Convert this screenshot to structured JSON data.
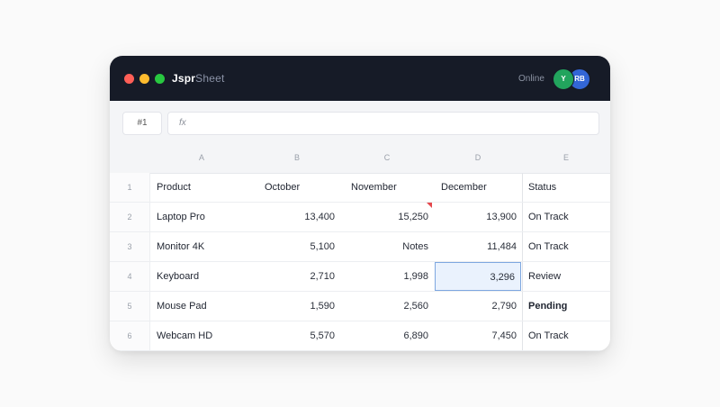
{
  "window": {
    "title_main": "Jspr",
    "title_accent": "Sheet",
    "online_label": "Online",
    "avatars": [
      {
        "initials": "Y",
        "color": "#22a45d"
      },
      {
        "initials": "RB",
        "color": "#3366d6"
      }
    ]
  },
  "formula_bar": {
    "cell_ref": "#1",
    "fx_label": "fx",
    "value": ""
  },
  "grid": {
    "columns": [
      "A",
      "B",
      "C",
      "D",
      "E"
    ],
    "rows": [
      {
        "num": "1",
        "product": "Product",
        "oct": "October",
        "nov": "November",
        "dec": "December",
        "status": "Status"
      },
      {
        "num": "2",
        "product": "Laptop Pro",
        "oct": "13,400",
        "nov": "15,250",
        "dec": "13,900",
        "status": "On Track"
      },
      {
        "num": "3",
        "product": "Monitor 4K",
        "oct": "5,100",
        "nov": "Notes",
        "dec": "11,484",
        "status": "On Track"
      },
      {
        "num": "4",
        "product": "Keyboard",
        "oct": "2,710",
        "nov": "1,998",
        "dec": "3,296",
        "status": "Review"
      },
      {
        "num": "5",
        "product": "Mouse Pad",
        "oct": "1,590",
        "nov": "2,560",
        "dec": "2,790",
        "status": "Pending"
      },
      {
        "num": "6",
        "product": "Webcam HD",
        "oct": "5,570",
        "nov": "6,890",
        "dec": "7,450",
        "status": "On Track"
      }
    ]
  },
  "colors": {
    "titlebar": "#161b27",
    "selection": "#7ea7e0",
    "note_flag": "#e5484d"
  }
}
